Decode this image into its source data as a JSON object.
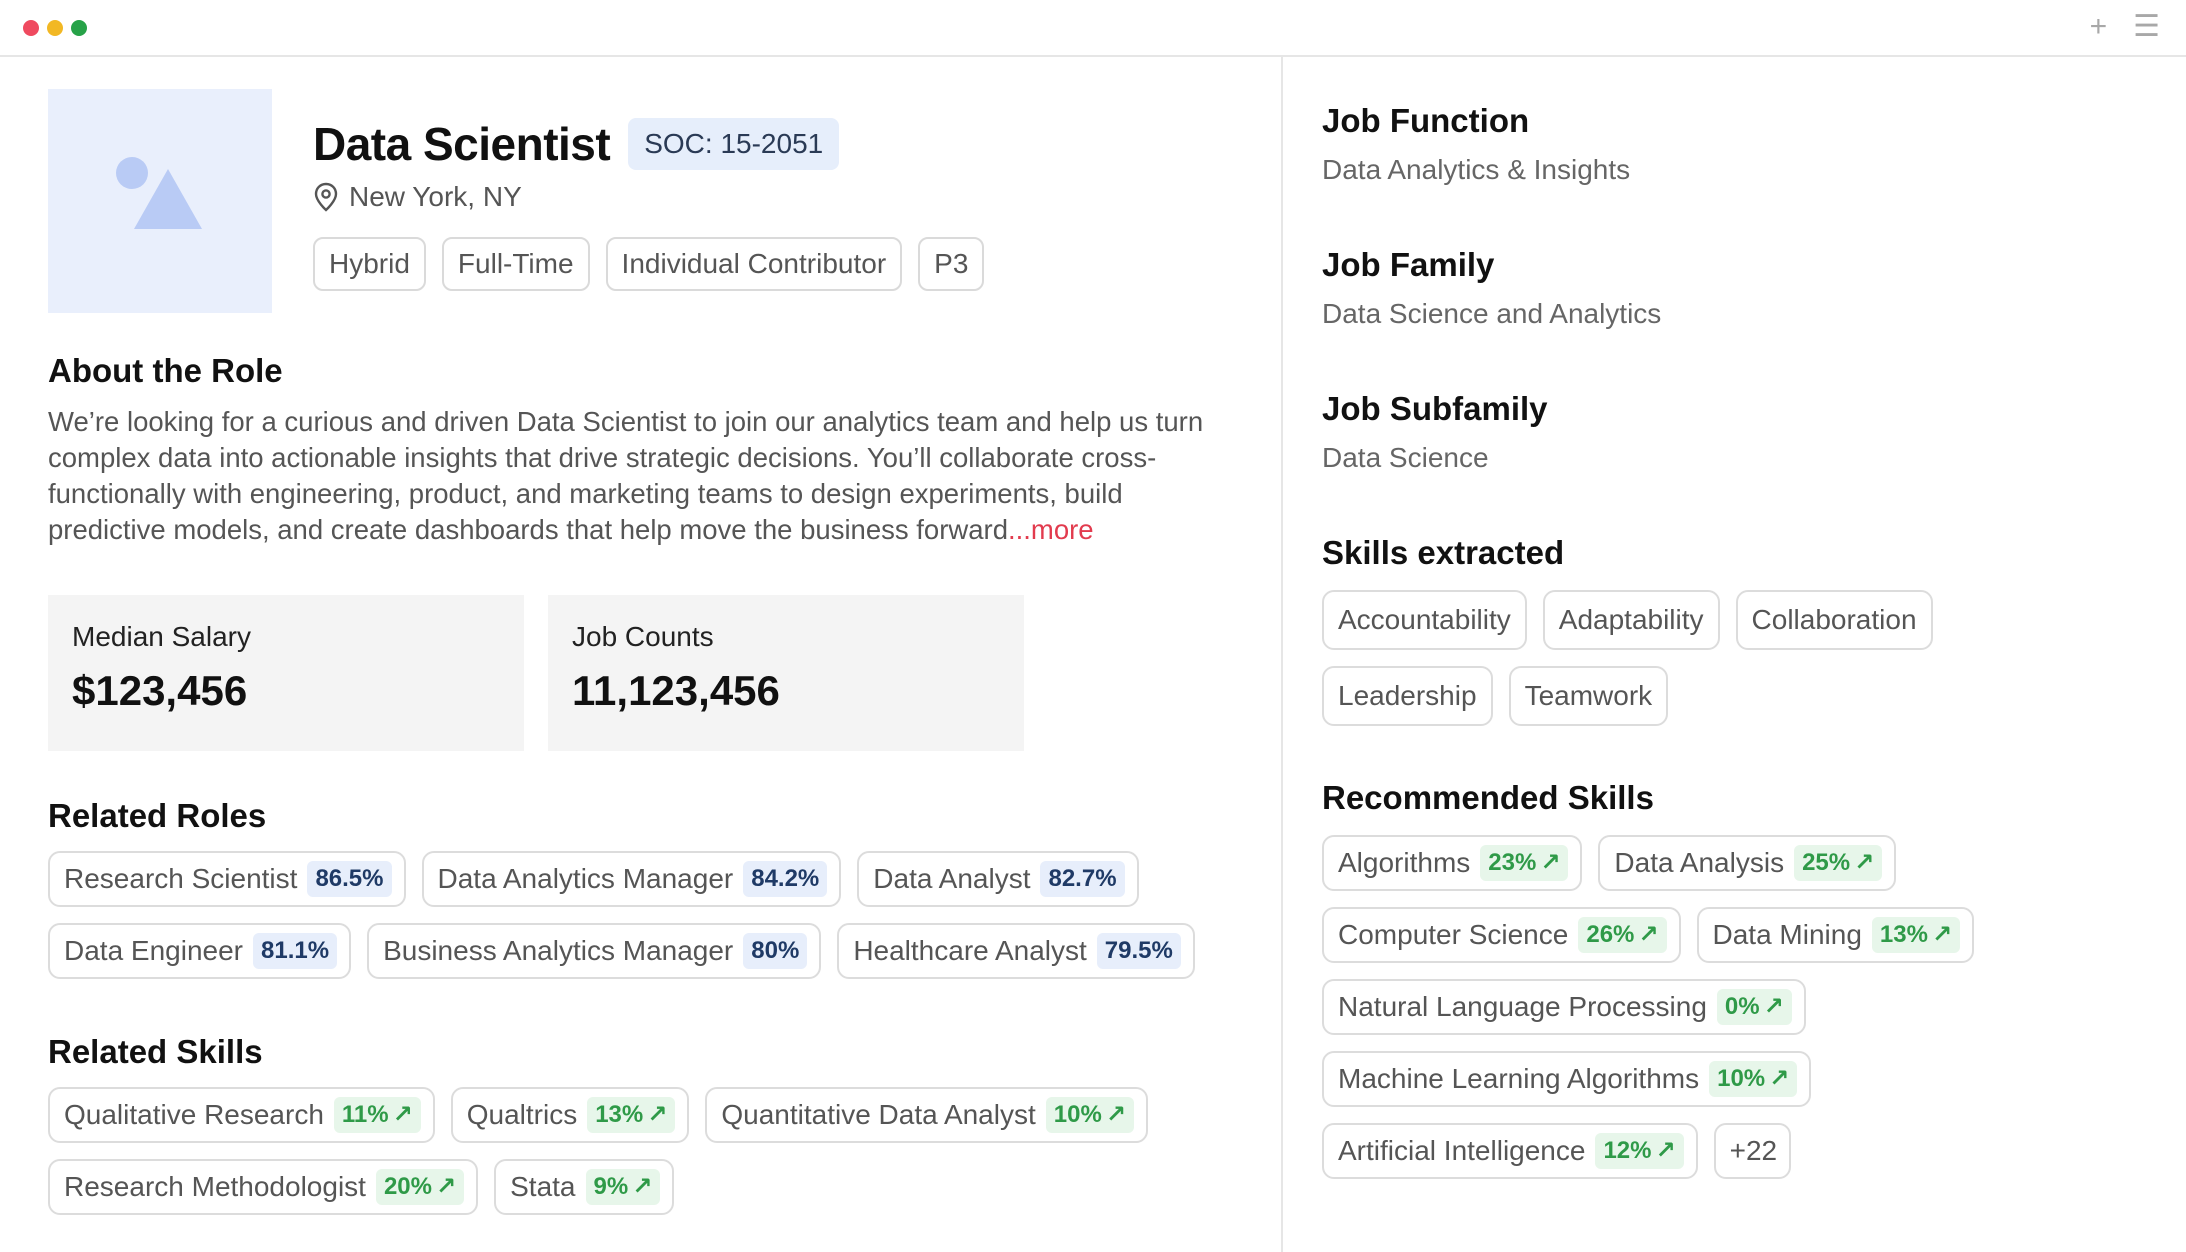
{
  "window": {
    "titlebar_icons": [
      "plus-icon",
      "menu-icon"
    ]
  },
  "job": {
    "title": "Data Scientist",
    "soc": "SOC: 15-2051",
    "location": "New York, NY",
    "tags": [
      "Hybrid",
      "Full-Time",
      "Individual Contributor",
      "P3"
    ]
  },
  "about": {
    "heading": "About the Role",
    "text": "We’re looking for a curious and driven Data Scientist to join our analytics team and help us turn complex data into actionable insights that drive strategic decisions. You’ll collaborate cross-functionally with engineering, product, and marketing teams to design experiments, build predictive models, and create dashboards that help move the business forward",
    "more": "...more"
  },
  "stats": {
    "salary_label": "Median Salary",
    "salary_value": "$123,456",
    "counts_label": "Job Counts",
    "counts_value": "11,123,456"
  },
  "related_roles": {
    "heading": "Related Roles",
    "items": [
      {
        "label": "Research Scientist",
        "pct": "86.5%"
      },
      {
        "label": "Data Analytics Manager",
        "pct": "84.2%"
      },
      {
        "label": "Data Analyst",
        "pct": "82.7%"
      },
      {
        "label": "Data Engineer",
        "pct": "81.1%"
      },
      {
        "label": "Business Analytics Manager",
        "pct": "80%"
      },
      {
        "label": "Healthcare Analyst",
        "pct": "79.5%"
      }
    ]
  },
  "related_skills": {
    "heading": "Related Skills",
    "items": [
      {
        "label": "Qualitative Research",
        "pct": "11%"
      },
      {
        "label": "Qualtrics",
        "pct": "13%"
      },
      {
        "label": "Quantitative Data Analyst",
        "pct": "10%"
      },
      {
        "label": "Research Methodologist",
        "pct": "20%"
      },
      {
        "label": "Stata",
        "pct": "9%"
      }
    ]
  },
  "side": {
    "job_function_label": "Job Function",
    "job_function": "Data Analytics & Insights",
    "job_family_label": "Job Family",
    "job_family": "Data Science and Analytics",
    "job_subfamily_label": "Job Subfamily",
    "job_subfamily": "Data Science",
    "skills_extracted_label": "Skills extracted",
    "skills_extracted": [
      "Accountability",
      "Adaptability",
      "Collaboration",
      "Leadership",
      "Teamwork"
    ],
    "recommended_label": "Recommended Skills",
    "recommended": [
      {
        "label": "Algorithms",
        "pct": "23%"
      },
      {
        "label": "Data Analysis",
        "pct": "25%"
      },
      {
        "label": "Computer Science",
        "pct": "26%"
      },
      {
        "label": "Data Mining",
        "pct": "13%"
      },
      {
        "label": "Natural Language Processing",
        "pct": "0%"
      },
      {
        "label": "Machine Learning Algorithms",
        "pct": "10%"
      },
      {
        "label": "Artificial Intelligence",
        "pct": "12%"
      }
    ],
    "more_count": "+22"
  },
  "colors": {
    "accent_red": "#e23b4e",
    "pct_blue_bg": "#e7eefb",
    "pct_green_bg": "#e7f6ea",
    "pct_green_text": "#2f9a48"
  }
}
